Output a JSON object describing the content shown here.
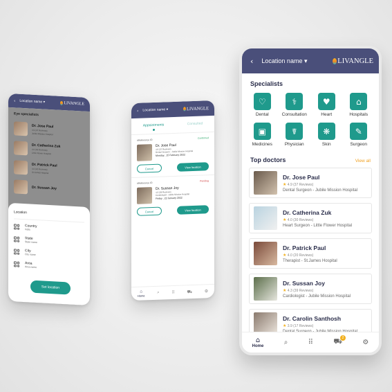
{
  "colors": {
    "header": "#4a4f7a",
    "accent": "#1f9a8c",
    "star": "#f2b01e",
    "view_all": "#f0a020"
  },
  "brand": {
    "logo_text": "LIVANGLE"
  },
  "phone1": {
    "header_location": "Location name",
    "title": "Eye specialists",
    "doctors": [
      {
        "name": "Dr. Jose Paul",
        "rating": "4.9 (37 Reviews)",
        "hospital": "Jubile Mission Hospital"
      },
      {
        "name": "Dr. Catherina Zuk",
        "rating": "4.0 (30 Reviews)",
        "hospital": "Little Flower Hospital"
      },
      {
        "name": "Dr. Patrick Paul",
        "rating": "4.0 (20 Reviews)",
        "hospital": "St.James Hospital"
      },
      {
        "name": "Dr. Sussan Joy",
        "rating": "",
        "hospital": ""
      }
    ],
    "sheet": {
      "title": "Location",
      "fields": [
        {
          "label": "Country",
          "value": "India"
        },
        {
          "label": "State",
          "value": "State name"
        },
        {
          "label": "City",
          "value": "City name"
        },
        {
          "label": "Area",
          "value": "Area name"
        }
      ],
      "button": "Set location"
    }
  },
  "phone2": {
    "header_location": "Location name",
    "tabs": [
      {
        "label": "Appointments"
      },
      {
        "label": "Consulted"
      }
    ],
    "appointments": [
      {
        "ref": "#Reference ID",
        "status": "Confirmed",
        "name": "Dr. Jose Paul",
        "rating": "4.9 (37 Reviews)",
        "spec": "Dental Surgeon - Jubile Mission Hospital",
        "date": "Monday , 15 February 2022",
        "cancel": "Cancel",
        "view": "View location"
      },
      {
        "ref": "#Reference ID",
        "status": "Pending",
        "name": "Dr. Sussan Joy",
        "rating": "4.3 (39 Reviews)",
        "spec": "Cardiologist - Jubile Mission Hospital",
        "date": "Friday , 22 January 2022",
        "cancel": "Cancel",
        "view": "View location"
      }
    ],
    "nav_home": "Home"
  },
  "phone3": {
    "header_location": "Location name",
    "specialists_title": "Specialists",
    "specialists": [
      {
        "label": "Dental",
        "icon": "tooth-icon",
        "glyph": "♡"
      },
      {
        "label": "Consultation",
        "icon": "stethoscope-icon",
        "glyph": "⚕"
      },
      {
        "label": "Heart",
        "icon": "heart-icon",
        "glyph": "♥"
      },
      {
        "label": "Hospitals",
        "icon": "hospital-icon",
        "glyph": "⌂"
      },
      {
        "label": "Medicines",
        "icon": "medicine-icon",
        "glyph": "▣"
      },
      {
        "label": "Physician",
        "icon": "physician-icon",
        "glyph": "☤"
      },
      {
        "label": "Skin",
        "icon": "skin-icon",
        "glyph": "❋"
      },
      {
        "label": "Surgeon",
        "icon": "scalpel-icon",
        "glyph": "✎"
      }
    ],
    "top_doctors_title": "Top doctors",
    "view_all": "View all",
    "doctors": [
      {
        "name": "Dr. Jose Paul",
        "rating": "4.9 (37 Reviews)",
        "spec": "Dental Surgeon - Jubile Mission Hospital"
      },
      {
        "name": "Dr. Catherina Zuk",
        "rating": "4.0 (30 Reviews)",
        "spec": "Heart Surgeon - Little Flower Hospital"
      },
      {
        "name": "Dr. Patrick Paul",
        "rating": "4.0 (20 Reviews)",
        "spec": "Therapist - St.James Hospital"
      },
      {
        "name": "Dr. Sussan Joy",
        "rating": "4.3 (39 Reviews)",
        "spec": "Cardiologist - Jubile Mission Hospital"
      },
      {
        "name": "Dr. Carolin Santhosh",
        "rating": "3.9 (17 Reviews)",
        "spec": "Dental Surgeon - Jubile Mission Hospital"
      }
    ],
    "nav_home": "Home",
    "cart_badge": "2"
  }
}
